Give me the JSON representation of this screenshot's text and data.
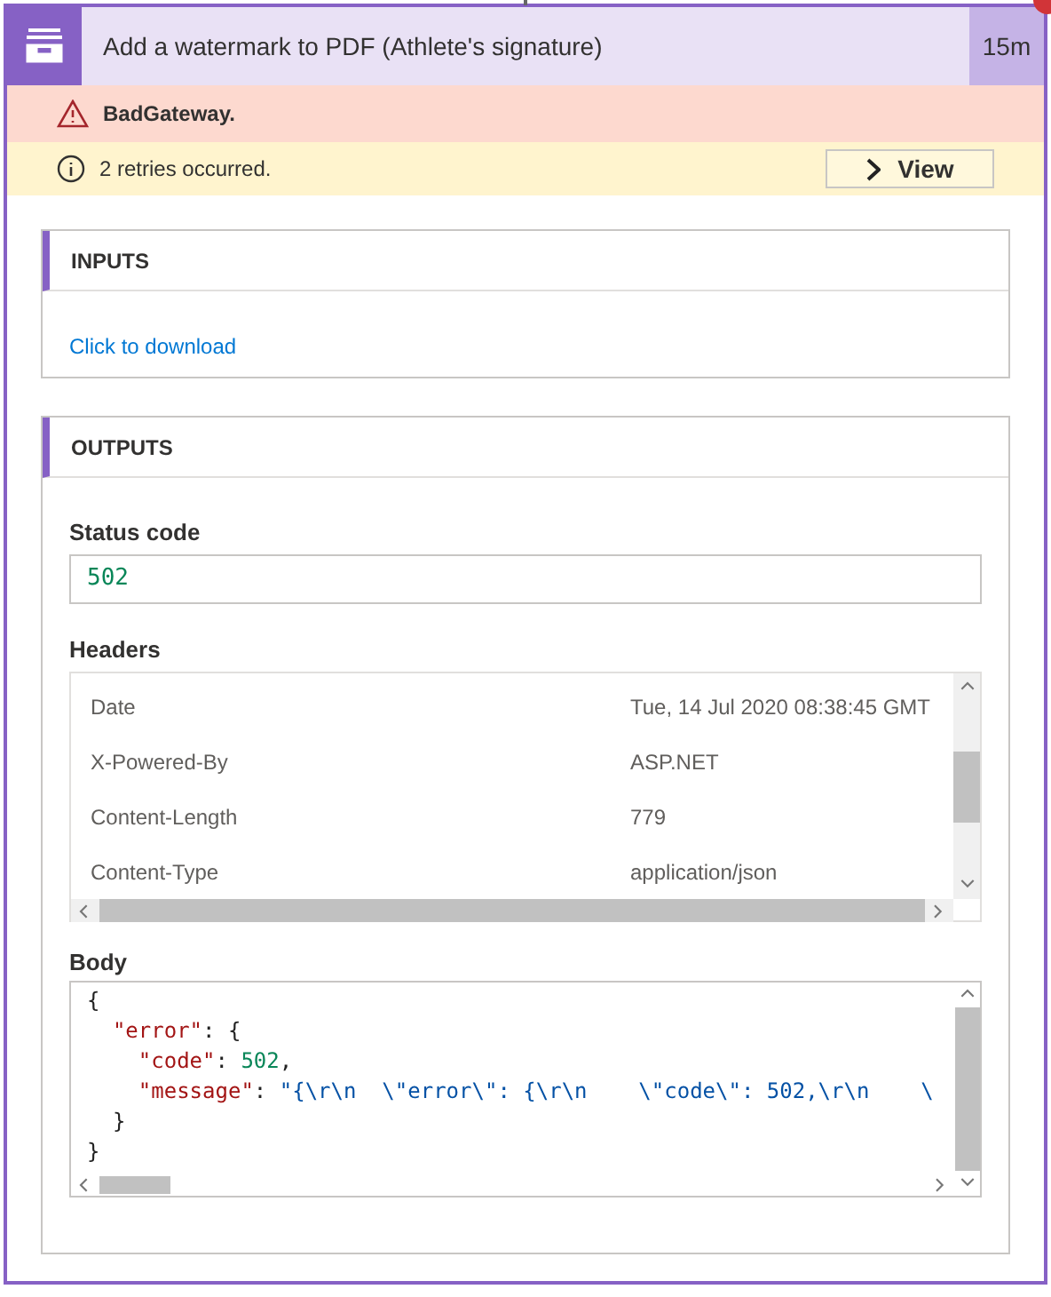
{
  "action": {
    "title": "Add a watermark to PDF (Athlete's signature)",
    "duration": "15m",
    "failed": true
  },
  "error_bar": {
    "message": "BadGateway."
  },
  "retry_bar": {
    "message": "2 retries occurred.",
    "button": "View"
  },
  "inputs": {
    "title": "INPUTS",
    "link": "Click to download"
  },
  "outputs": {
    "title": "OUTPUTS",
    "status_label": "Status code",
    "status_code": "502",
    "headers_label": "Headers",
    "headers": [
      {
        "name": "Date",
        "value": "Tue, 14 Jul 2020 08:38:45 GMT"
      },
      {
        "name": "X-Powered-By",
        "value": "ASP.NET"
      },
      {
        "name": "Content-Length",
        "value": "779"
      },
      {
        "name": "Content-Type",
        "value": "application/json"
      }
    ],
    "body_label": "Body",
    "body_lines": [
      [
        {
          "kind": "punct",
          "text": "{"
        }
      ],
      [
        {
          "kind": "key",
          "text": "  \"error\""
        },
        {
          "kind": "punct",
          "text": ": {"
        }
      ],
      [
        {
          "kind": "key",
          "text": "    \"code\""
        },
        {
          "kind": "punct",
          "text": ": "
        },
        {
          "kind": "number",
          "text": "502"
        },
        {
          "kind": "punct",
          "text": ","
        }
      ],
      [
        {
          "kind": "key",
          "text": "    \"message\""
        },
        {
          "kind": "punct",
          "text": ": "
        },
        {
          "kind": "string",
          "text": "\"{\\r\\n  \\\"error\\\": {\\r\\n    \\\"code\\\": 502,\\r\\n    \\"
        }
      ],
      [
        {
          "kind": "punct",
          "text": "  }"
        }
      ],
      [
        {
          "kind": "punct",
          "text": "}"
        }
      ]
    ]
  }
}
